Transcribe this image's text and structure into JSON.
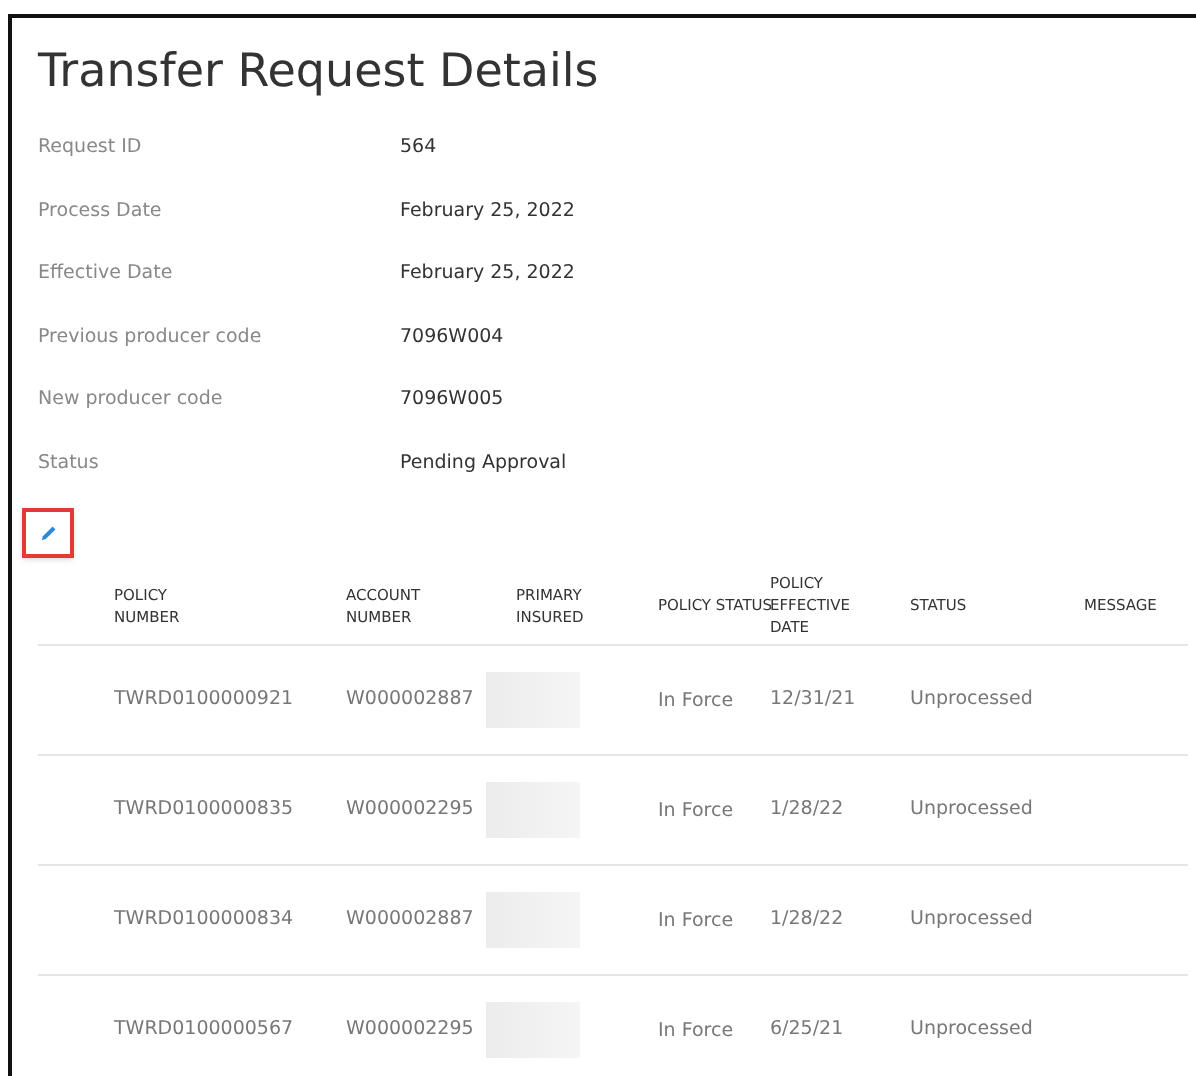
{
  "title": "Transfer Request Details",
  "details": [
    {
      "label": "Request ID",
      "value": "564"
    },
    {
      "label": "Process Date",
      "value": "February 25, 2022"
    },
    {
      "label": "Effective Date",
      "value": "February 25, 2022"
    },
    {
      "label": "Previous producer code",
      "value": "7096W004"
    },
    {
      "label": "New producer code",
      "value": "7096W005"
    },
    {
      "label": "Status",
      "value": "Pending Approval"
    }
  ],
  "edit_button": {
    "highlighted": true
  },
  "table": {
    "columns": [
      "POLICY NUMBER",
      "ACCOUNT NUMBER",
      "PRIMARY INSURED",
      "POLICY STATUS",
      "POLICY EFFECTIVE DATE",
      "STATUS",
      "MESSAGE"
    ],
    "rows": [
      {
        "policy_number": "TWRD0100000921",
        "account_number": "W000002887",
        "primary_insured_redacted": true,
        "policy_status": "In Force",
        "effective_date": "12/31/21",
        "status": "Unprocessed"
      },
      {
        "policy_number": "TWRD0100000835",
        "account_number": "W000002295",
        "primary_insured_redacted": true,
        "policy_status": "In Force",
        "effective_date": "1/28/22",
        "status": "Unprocessed"
      },
      {
        "policy_number": "TWRD0100000834",
        "account_number": "W000002887",
        "primary_insured_redacted": true,
        "policy_status": "In Force",
        "effective_date": "1/28/22",
        "status": "Unprocessed"
      },
      {
        "policy_number": "TWRD0100000567",
        "account_number": "W000002295",
        "primary_insured_redacted": true,
        "policy_status": "In Force",
        "effective_date": "6/25/21",
        "status": "Unprocessed"
      }
    ]
  }
}
